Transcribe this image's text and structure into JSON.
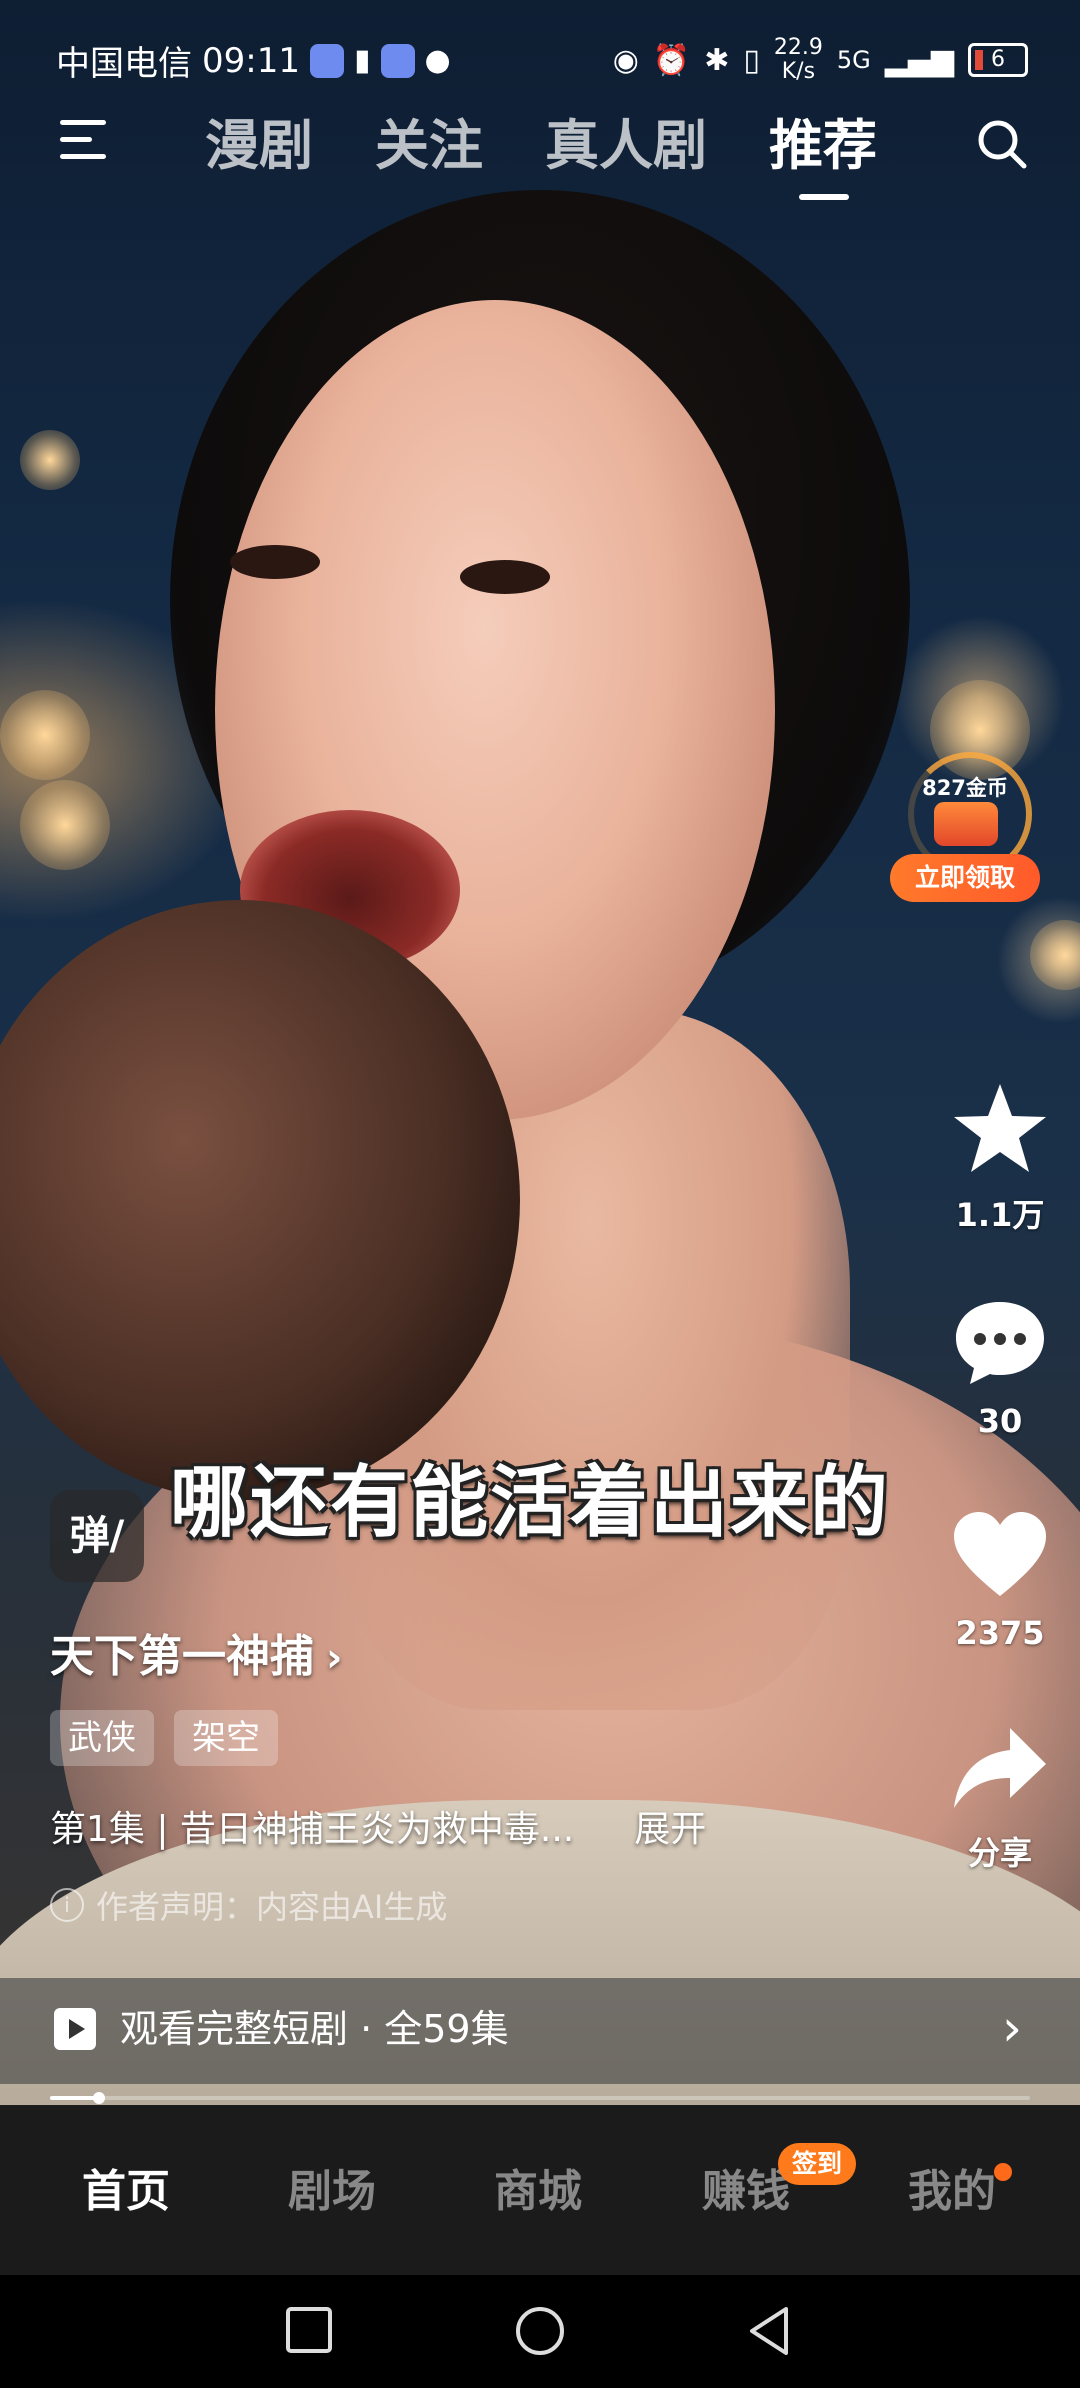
{
  "status_bar": {
    "carrier": "中国电信",
    "time": "09:11",
    "net_speed_value": "22.9",
    "net_speed_unit": "K/s",
    "network": "5G",
    "battery": "6"
  },
  "top_nav": {
    "tabs": [
      {
        "label": "漫剧"
      },
      {
        "label": "关注"
      },
      {
        "label": "真人剧"
      },
      {
        "label": "推荐"
      }
    ],
    "active_tab": "推荐"
  },
  "coin_widget": {
    "amount": "827金币",
    "claim_label": "立即领取"
  },
  "caption": "哪还有能活着出来的",
  "danmu_label": "弹/",
  "actions": {
    "favorite_count": "1.1万",
    "comment_count": "30",
    "like_count": "2375",
    "share_label": "分享"
  },
  "drama": {
    "title": "天下第一神捕",
    "title_chevron": "›",
    "tags": [
      "武侠",
      "架空"
    ],
    "description": "第1集 | 昔日神捕王炎为救中毒...",
    "expand_label": "展开",
    "ai_notice": "作者声明：内容由AI生成"
  },
  "watch_full": {
    "label": "观看完整短剧 · 全59集",
    "arrow": "›"
  },
  "playback_progress": 0.05,
  "bottom_nav": {
    "items": [
      {
        "label": "首页"
      },
      {
        "label": "剧场"
      },
      {
        "label": "商城"
      },
      {
        "label": "赚钱"
      },
      {
        "label": "我的"
      }
    ],
    "active": "首页",
    "badge": "签到"
  },
  "colors": {
    "accent_orange": "#ff7a1a",
    "nav_background": "#1b1b1b"
  }
}
